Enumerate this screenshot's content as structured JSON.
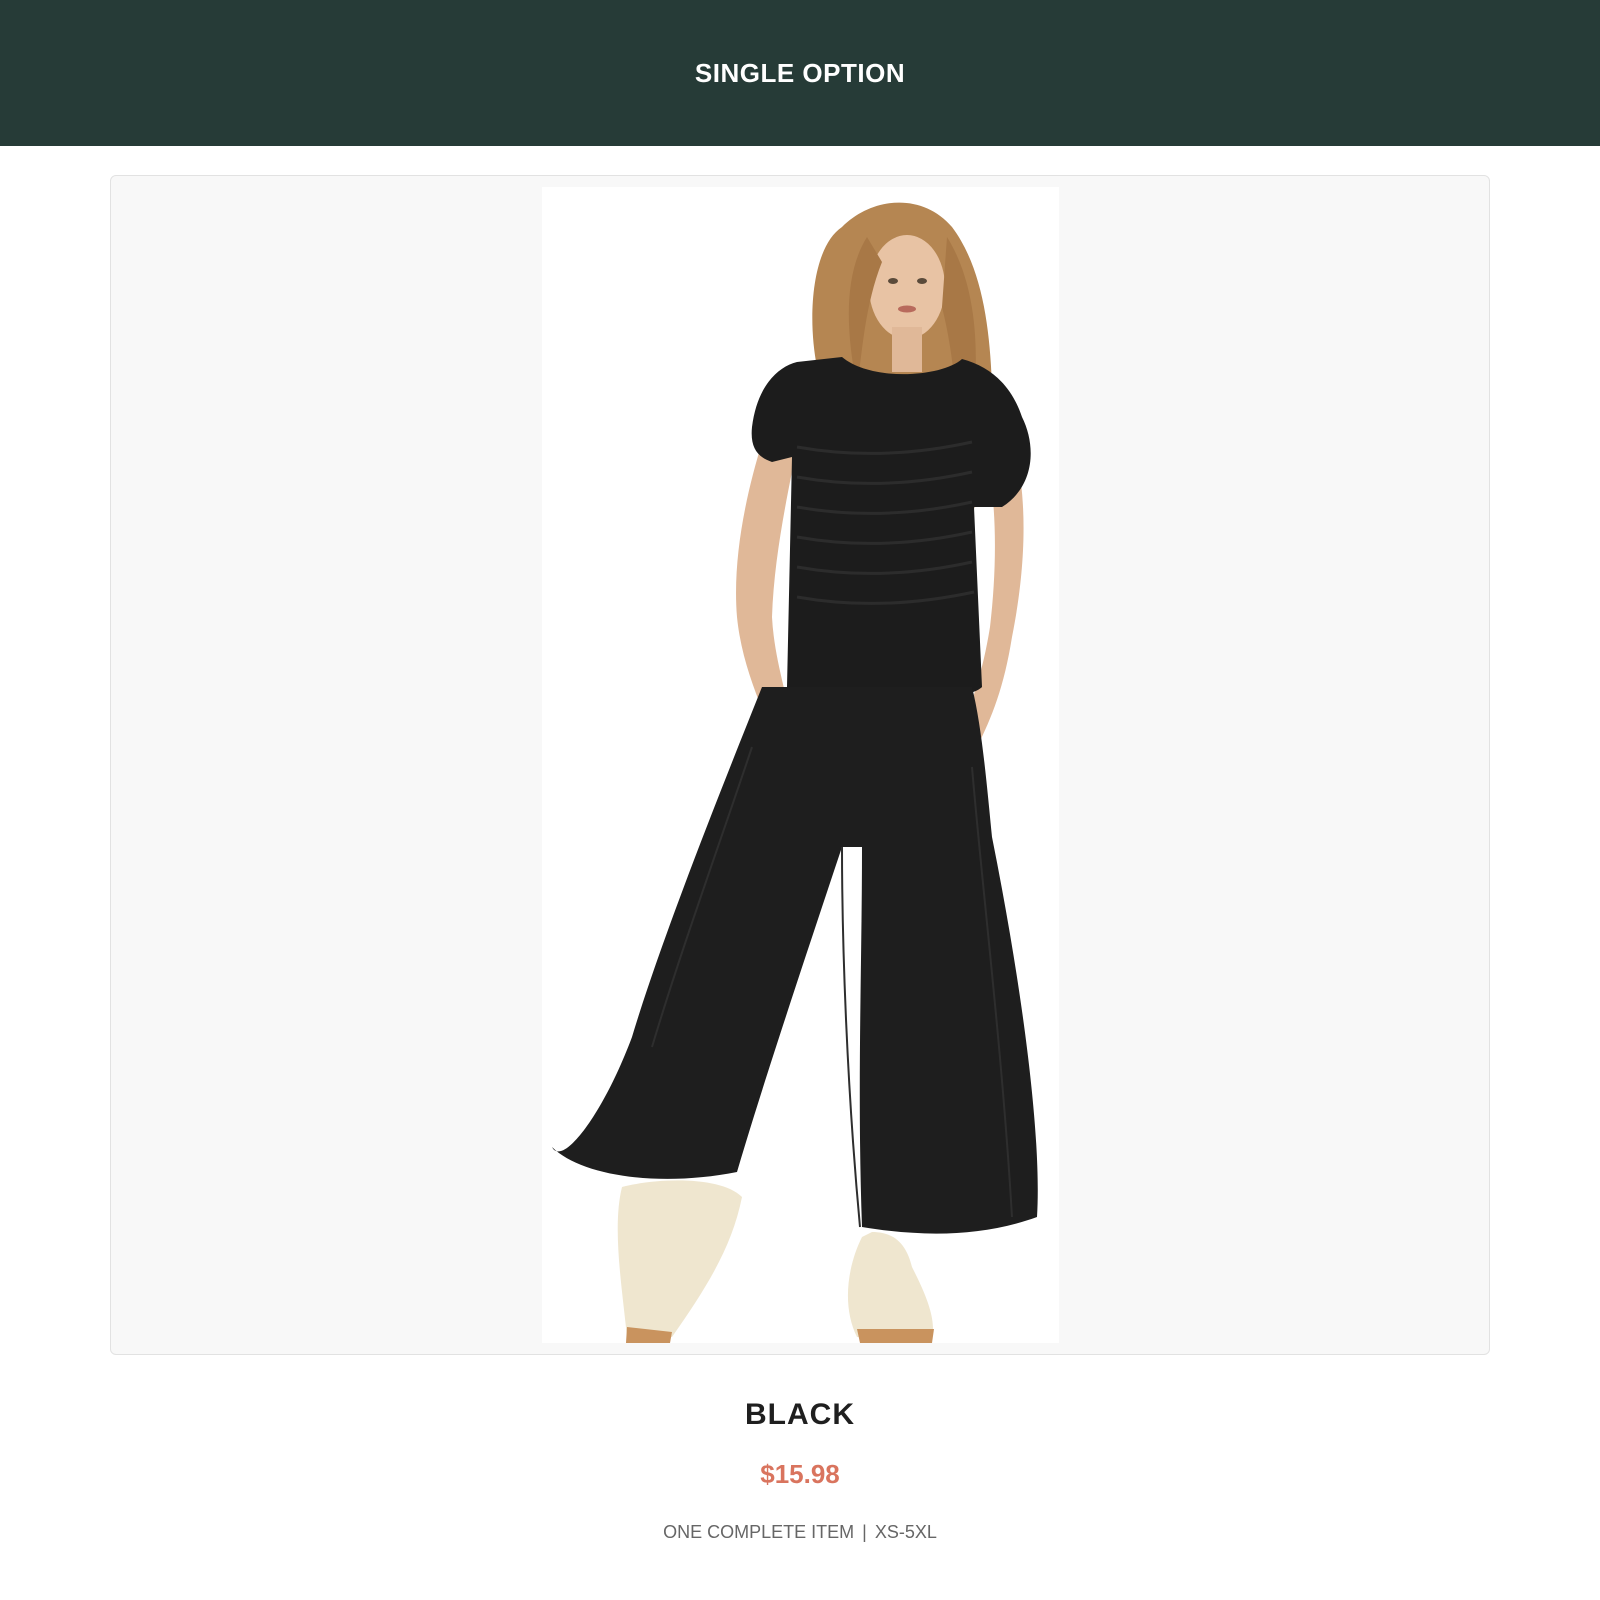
{
  "header": {
    "title": "SINGLE OPTION",
    "background_color": "#263b37"
  },
  "product": {
    "image_alt": "Model wearing black smocked short-sleeve top and wide-leg pants with cream sneakers",
    "variant_name": "BLACK",
    "price": "$15.98",
    "price_color": "#d9745e",
    "meta_left": "ONE COMPLETE ITEM",
    "meta_separator": "|",
    "meta_right": "XS-5XL"
  }
}
